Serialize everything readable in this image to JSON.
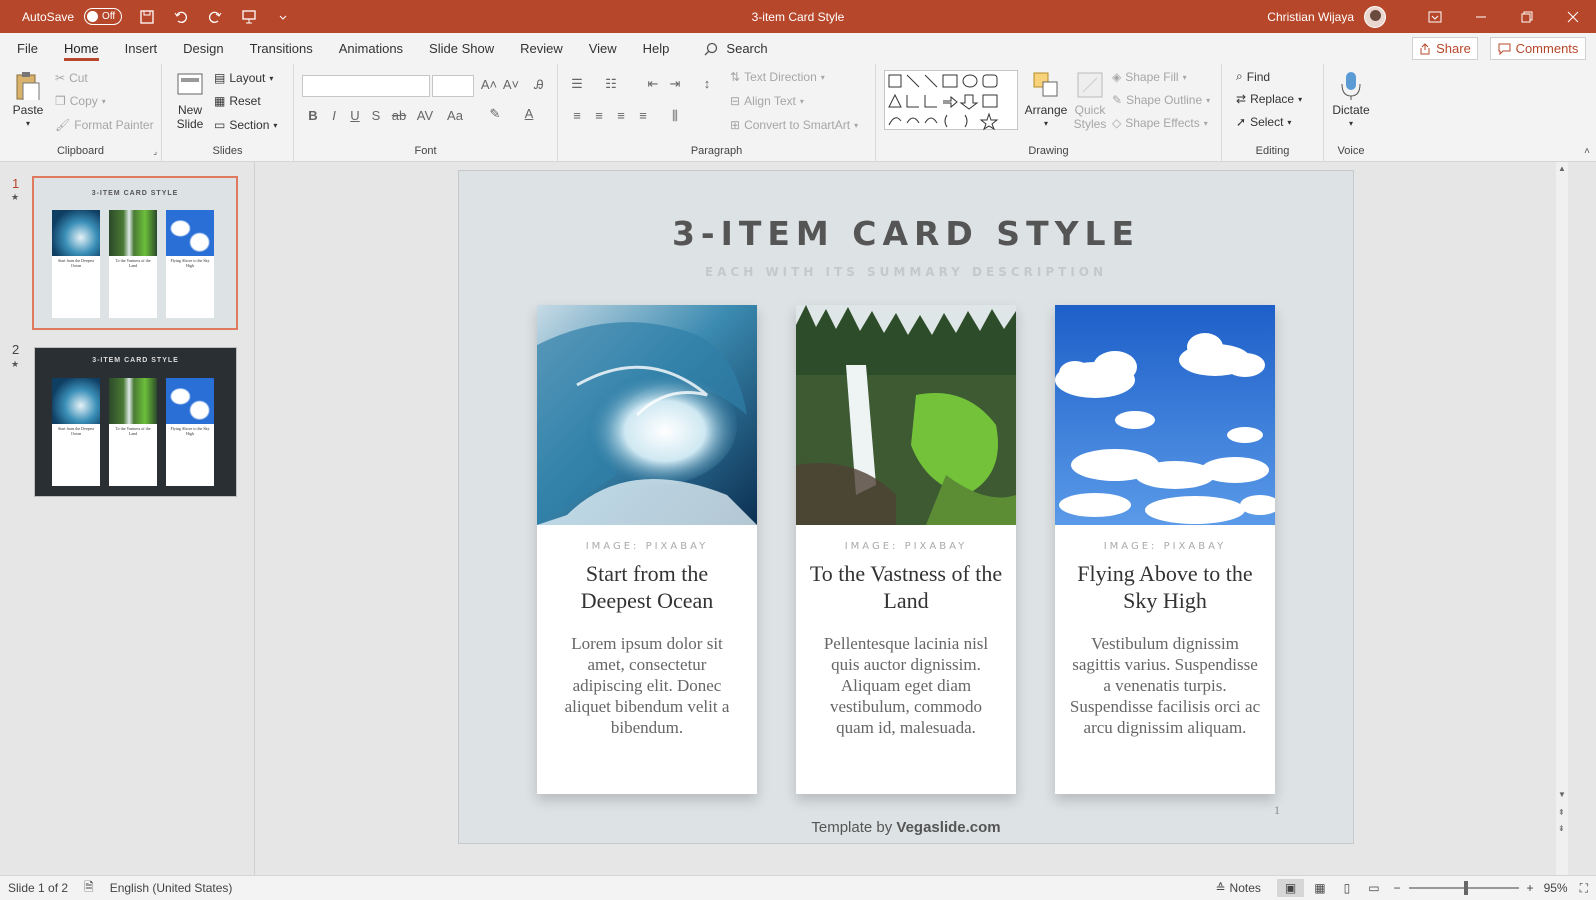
{
  "titlebar": {
    "autosave_label": "AutoSave",
    "autosave_state": "Off",
    "doc_title": "3-item Card Style",
    "user_name": "Christian Wijaya"
  },
  "tabs": [
    "File",
    "Home",
    "Insert",
    "Design",
    "Transitions",
    "Animations",
    "Slide Show",
    "Review",
    "View",
    "Help"
  ],
  "search_label": "Search",
  "share_label": "Share",
  "comments_label": "Comments",
  "ribbon": {
    "clipboard": {
      "paste": "Paste",
      "cut": "Cut",
      "copy": "Copy",
      "format_painter": "Format Painter",
      "label": "Clipboard"
    },
    "slides": {
      "new_slide_line1": "New",
      "new_slide_line2": "Slide",
      "layout": "Layout",
      "reset": "Reset",
      "section": "Section",
      "label": "Slides"
    },
    "font": {
      "label": "Font"
    },
    "paragraph": {
      "text_direction": "Text Direction",
      "align_text": "Align Text",
      "convert_smartart": "Convert to SmartArt",
      "label": "Paragraph"
    },
    "drawing": {
      "arrange": "Arrange",
      "quick_line1": "Quick",
      "quick_line2": "Styles",
      "shape_fill": "Shape Fill",
      "shape_outline": "Shape Outline",
      "shape_effects": "Shape Effects",
      "label": "Drawing"
    },
    "editing": {
      "find": "Find",
      "replace": "Replace",
      "select": "Select",
      "label": "Editing"
    },
    "voice": {
      "dictate": "Dictate",
      "label": "Voice"
    }
  },
  "thumbnails": {
    "slide1_num": "1",
    "slide2_num": "2",
    "title": "3-ITEM CARD STYLE"
  },
  "slide": {
    "title": "3-ITEM CARD STYLE",
    "subtitle": "EACH WITH ITS SUMMARY DESCRIPTION",
    "cards": [
      {
        "credit": "IMAGE: PIXABAY",
        "heading": "Start from the Deepest Ocean",
        "body": "Lorem ipsum dolor sit amet, consectetur adipiscing elit. Donec aliquet bibendum velit a bibendum.",
        "image": "ocean-wave"
      },
      {
        "credit": "IMAGE: PIXABAY",
        "heading": "To the Vastness of the Land",
        "body": "Pellentesque lacinia nisl quis auctor dignissim. Aliquam eget diam vestibulum, commodo quam id, malesuada.",
        "image": "waterfall-forest"
      },
      {
        "credit": "IMAGE: PIXABAY",
        "heading": "Flying Above to the Sky High",
        "body": "Vestibulum dignissim sagittis varius. Suspendisse a venenatis turpis. Suspendisse facilisis orci ac arcu dignissim aliquam.",
        "image": "blue-sky-clouds"
      }
    ],
    "page_number": "1",
    "footer_prefix": "Template by ",
    "footer_brand": "Vegaslide.com"
  },
  "statusbar": {
    "slide_info": "Slide 1 of 2",
    "language": "English (United States)",
    "notes": "Notes",
    "zoom": "95%"
  },
  "colors": {
    "accent": "#b7472a",
    "slide_bg": "#dde2e4"
  }
}
